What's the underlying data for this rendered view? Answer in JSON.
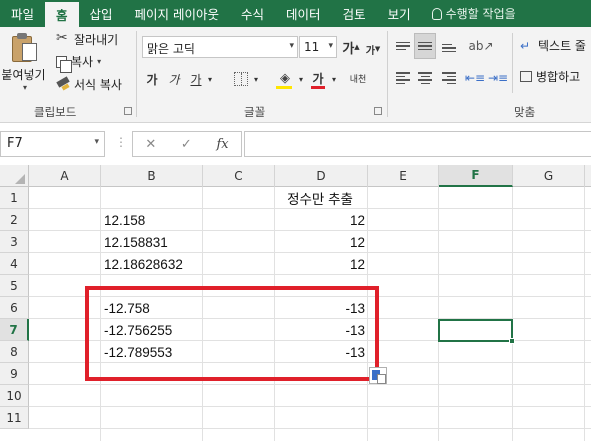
{
  "ribbon_tabs": [
    {
      "label": "파일",
      "active": false
    },
    {
      "label": "홈",
      "active": true
    },
    {
      "label": "삽입",
      "active": false
    },
    {
      "label": "페이지 레이아웃",
      "active": false
    },
    {
      "label": "수식",
      "active": false
    },
    {
      "label": "데이터",
      "active": false
    },
    {
      "label": "검토",
      "active": false
    },
    {
      "label": "보기",
      "active": false
    }
  ],
  "tell_me": "수행할 작업을",
  "clipboard": {
    "paste": "붙여넣기",
    "cut": "잘라내기",
    "copy": "복사",
    "format_painter": "서식 복사",
    "group_label": "클립보드"
  },
  "font": {
    "name": "맑은 고딕",
    "size": "11",
    "grow": "가",
    "shrink": "가",
    "bold": "가",
    "italic": "가",
    "underline": "가",
    "font_color": "가",
    "phonetic": "내천",
    "group_label": "글꼴"
  },
  "alignment": {
    "wrap_text": "텍스트 줄",
    "merge": "병합하고",
    "group_label": "맞춤"
  },
  "formula_bar": {
    "name_box": "F7",
    "cancel": "✕",
    "enter": "✓",
    "fx": "fx",
    "value": ""
  },
  "columns": [
    "A",
    "B",
    "C",
    "D",
    "E",
    "F",
    "G"
  ],
  "selected_column": "F",
  "rows": [
    "1",
    "2",
    "3",
    "4",
    "5",
    "6",
    "7",
    "8",
    "9",
    "10",
    "11"
  ],
  "selected_row": "7",
  "cells": {
    "D1": "정수만 추출",
    "B2": "12.158",
    "D2": "12",
    "B3": "12.158831",
    "D3": "12",
    "B4": "12.18628632",
    "D4": "12",
    "B6": "-12.758",
    "D6": "-13",
    "B7": "-12.756255",
    "D7": "-13",
    "B8": "-12.789553",
    "D8": "-13"
  },
  "colors": {
    "ribbon_green": "#217346",
    "highlight_red": "#e0202a"
  }
}
